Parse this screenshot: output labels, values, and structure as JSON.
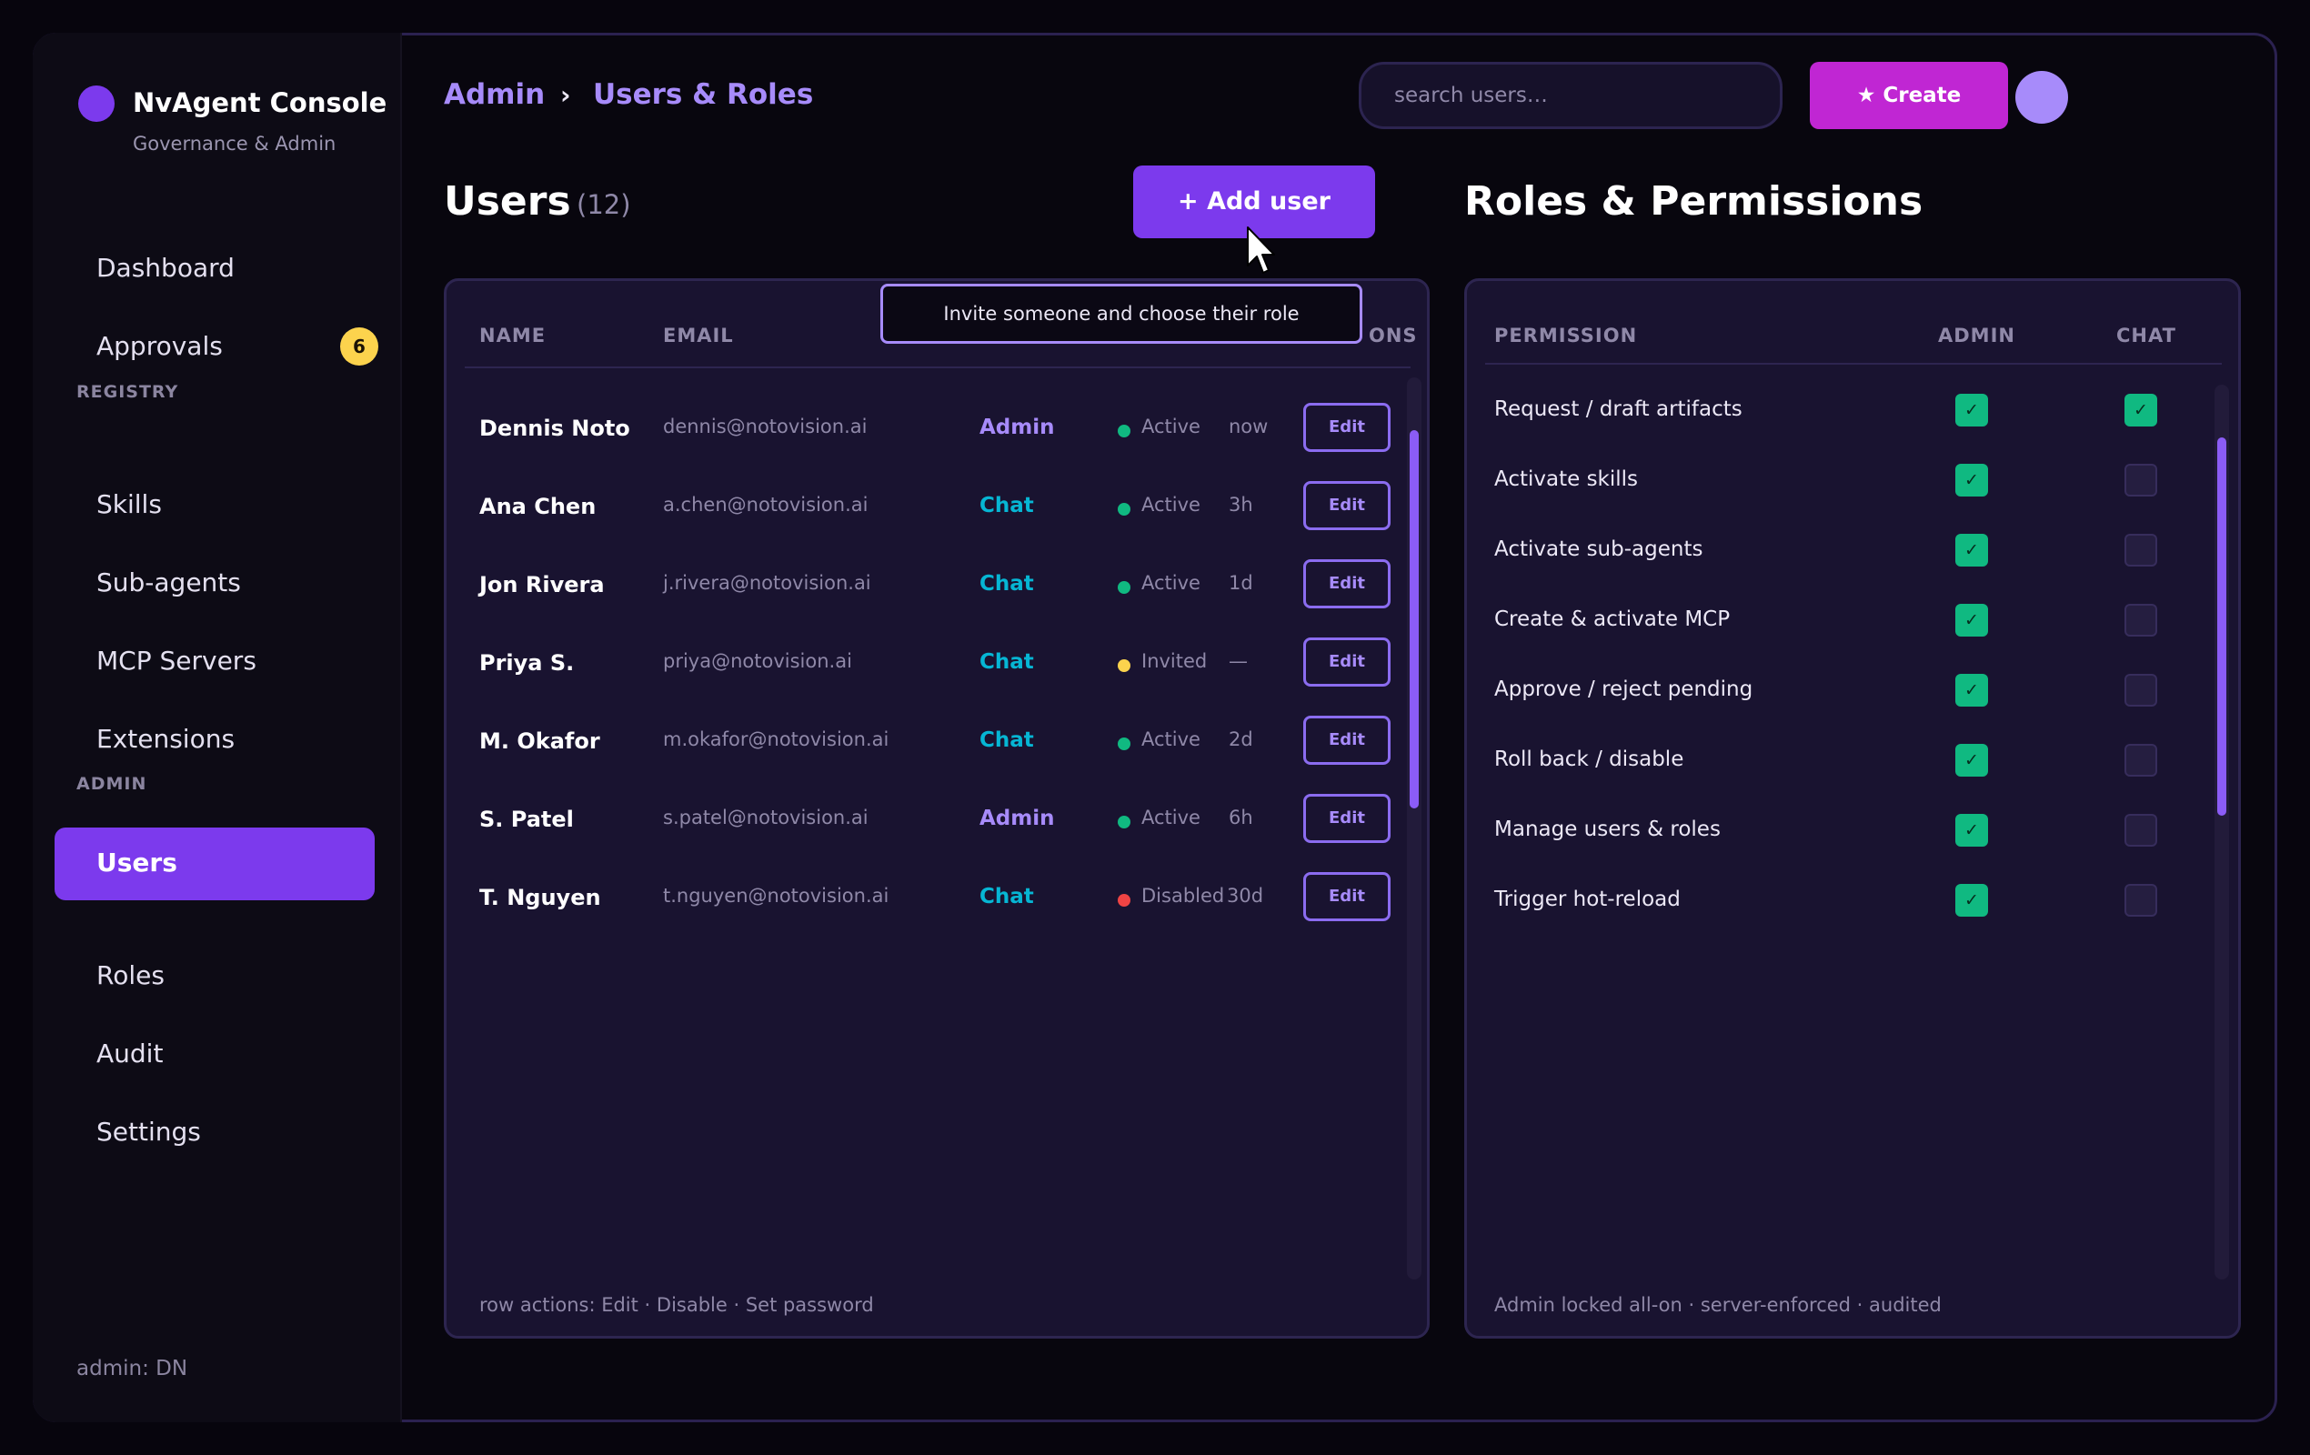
{
  "sidebar": {
    "brand_title": "NvAgent Console",
    "brand_subtitle": "Governance & Admin",
    "items": [
      {
        "label": "Dashboard"
      },
      {
        "label": "Approvals",
        "badge": "6"
      },
      {
        "label": "Skills"
      },
      {
        "label": "Sub-agents"
      },
      {
        "label": "MCP Servers"
      },
      {
        "label": "Extensions"
      },
      {
        "label": "Users"
      },
      {
        "label": "Roles"
      },
      {
        "label": "Audit"
      },
      {
        "label": "Settings"
      }
    ],
    "sections": [
      "REGISTRY",
      "ADMIN"
    ],
    "active_item": "Users",
    "footer": "admin: DN"
  },
  "header": {
    "breadcrumb": [
      "Admin",
      "Users & Roles"
    ],
    "breadcrumb_sep": "›",
    "search_placeholder": "search users…",
    "create_label": "★ Create"
  },
  "users": {
    "title": "Users",
    "count": "(12)",
    "add_label": "+  Add user",
    "tooltip": "Invite someone and choose their role",
    "columns": [
      "NAME",
      "EMAIL",
      "ONS"
    ],
    "rows": [
      {
        "name": "Dennis Noto",
        "email": "dennis@notovision.ai",
        "role": "Admin",
        "status": "Active",
        "last": "now",
        "action": "Edit"
      },
      {
        "name": "Ana Chen",
        "email": "a.chen@notovision.ai",
        "role": "Chat",
        "status": "Active",
        "last": "3h",
        "action": "Edit"
      },
      {
        "name": "Jon Rivera",
        "email": "j.rivera@notovision.ai",
        "role": "Chat",
        "status": "Active",
        "last": "1d",
        "action": "Edit"
      },
      {
        "name": "Priya S.",
        "email": "priya@notovision.ai",
        "role": "Chat",
        "status": "Invited",
        "last": "—",
        "action": "Edit"
      },
      {
        "name": "M. Okafor",
        "email": "m.okafor@notovision.ai",
        "role": "Chat",
        "status": "Active",
        "last": "2d",
        "action": "Edit"
      },
      {
        "name": "S. Patel",
        "email": "s.patel@notovision.ai",
        "role": "Admin",
        "status": "Active",
        "last": "6h",
        "action": "Edit"
      },
      {
        "name": "T. Nguyen",
        "email": "t.nguyen@notovision.ai",
        "role": "Chat",
        "status": "Disabled",
        "last": "30d",
        "action": "Edit"
      }
    ],
    "footnote": "row actions: Edit · Disable · Set password"
  },
  "roles": {
    "title": "Roles & Permissions",
    "columns": [
      "PERMISSION",
      "ADMIN",
      "CHAT"
    ],
    "rows": [
      {
        "label": "Request / draft artifacts",
        "admin": true,
        "chat": true
      },
      {
        "label": "Activate skills",
        "admin": true,
        "chat": false
      },
      {
        "label": "Activate sub-agents",
        "admin": true,
        "chat": false
      },
      {
        "label": "Create & activate MCP",
        "admin": true,
        "chat": false
      },
      {
        "label": "Approve / reject pending",
        "admin": true,
        "chat": false
      },
      {
        "label": "Roll back / disable",
        "admin": true,
        "chat": false
      },
      {
        "label": "Manage users & roles",
        "admin": true,
        "chat": false
      },
      {
        "label": "Trigger hot-reload",
        "admin": true,
        "chat": false
      }
    ],
    "check_glyph": "✓",
    "footnote": "Admin locked all-on · server-enforced · audited"
  },
  "colors": {
    "accent": "#7c3aed",
    "create": "#c026d3",
    "admin_role": "#a78bfa",
    "chat_role": "#06b6d4",
    "status_active": "#10b981",
    "status_invited": "#fcd34d",
    "status_disabled": "#ef4444"
  }
}
